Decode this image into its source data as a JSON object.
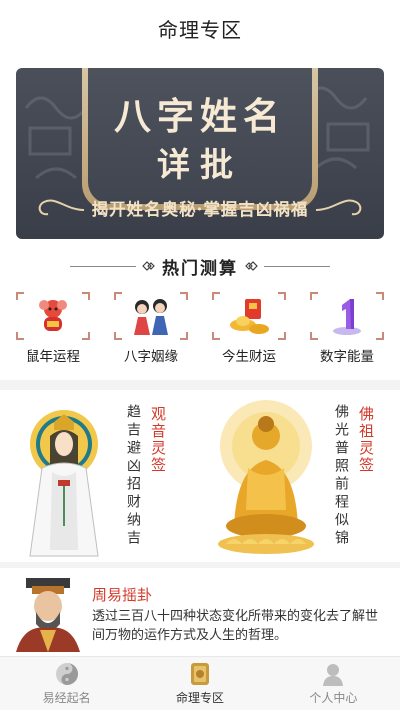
{
  "navbar": {
    "title": "命理专区"
  },
  "banner": {
    "title_line1": "八字姓名",
    "title_line2": "详批",
    "tagline": "揭开姓名奥秘·掌握吉凶祸福"
  },
  "hot_section": {
    "heading": "热门测算",
    "items": [
      {
        "label": "鼠年运程",
        "icon": "rat-icon"
      },
      {
        "label": "八字姻缘",
        "icon": "couple-icon"
      },
      {
        "label": "今生财运",
        "icon": "gold-ingot-icon"
      },
      {
        "label": "数字能量",
        "icon": "number-one-icon"
      }
    ]
  },
  "cards": {
    "guanyin": {
      "title": "观音灵签",
      "text": "趋吉避凶招财纳吉"
    },
    "fozu": {
      "title": "佛祖灵签",
      "text": "佛光普照前程似锦"
    }
  },
  "zhouyi": {
    "title": "周易摇卦",
    "desc": "透过三百八十四种状态变化所带来的变化去了解世间万物的运作方式及人生的哲理。"
  },
  "tabbar": {
    "tabs": [
      {
        "label": "易经起名",
        "icon": "yinyang-icon",
        "active": false
      },
      {
        "label": "命理专区",
        "icon": "book-icon",
        "active": true
      },
      {
        "label": "个人中心",
        "icon": "person-icon",
        "active": false
      }
    ]
  },
  "colors": {
    "accent_red": "#d33a2a",
    "banner_bg": "#434855",
    "gold": "#d9c8a6"
  }
}
